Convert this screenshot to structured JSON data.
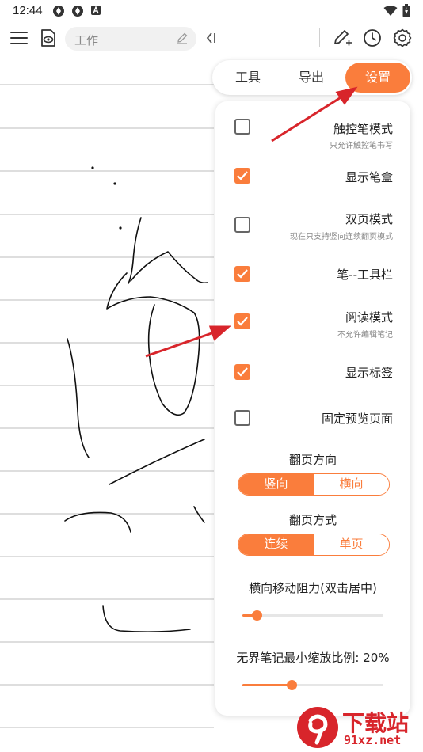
{
  "status_bar": {
    "time": "12:44"
  },
  "toolbar": {
    "note_title": "工作"
  },
  "tabs": [
    {
      "label": "工具"
    },
    {
      "label": "导出"
    },
    {
      "label": "设置",
      "active": true
    }
  ],
  "settings": {
    "options": [
      {
        "title": "触控笔模式",
        "subtitle": "只允许触控笔书写",
        "checked": false
      },
      {
        "title": "显示笔盒",
        "subtitle": "",
        "checked": true
      },
      {
        "title": "双页模式",
        "subtitle": "现在只支持竖向连续翻页模式",
        "checked": false
      },
      {
        "title": "笔--工具栏",
        "subtitle": "",
        "checked": true
      },
      {
        "title": "阅读模式",
        "subtitle": "不允许编辑笔记",
        "checked": true
      },
      {
        "title": "显示标签",
        "subtitle": "",
        "checked": true
      },
      {
        "title": "固定预览页面",
        "subtitle": "",
        "checked": false
      }
    ],
    "page_direction": {
      "label": "翻页方向",
      "options": [
        "竖向",
        "横向"
      ],
      "selected": "竖向"
    },
    "page_mode": {
      "label": "翻页方式",
      "options": [
        "连续",
        "单页"
      ],
      "selected": "连续"
    },
    "horizontal_resistance": {
      "label": "横向移动阻力(双击居中)",
      "value_fraction": 0.1
    },
    "min_zoom": {
      "label": "无界笔记最小缩放比例: 20%",
      "value_fraction": 0.35
    }
  },
  "watermark": {
    "brand": "下载站",
    "domain": "91xz.net"
  },
  "colors": {
    "accent": "#fa7d3c",
    "annotation_arrow": "#d8252b"
  }
}
